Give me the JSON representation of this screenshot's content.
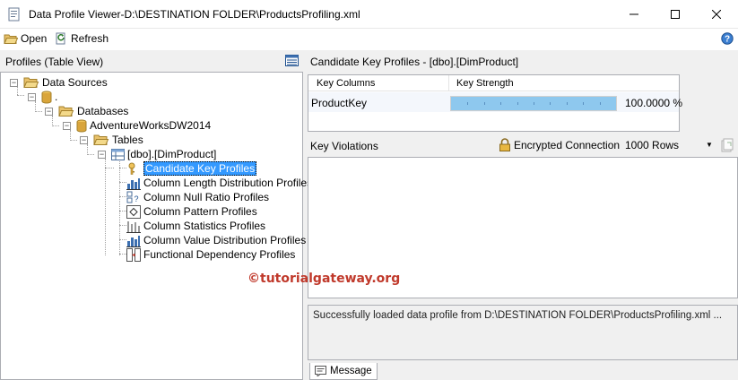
{
  "window": {
    "title": "Data Profile Viewer-D:\\DESTINATION FOLDER\\ProductsProfiling.xml",
    "app_icon": "document-icon",
    "controls": [
      "minimize-icon",
      "maximize-icon",
      "close-icon"
    ]
  },
  "toolbar": {
    "open_label": "Open",
    "refresh_label": "Refresh",
    "help_icon": "help-icon"
  },
  "left_panel": {
    "header": "Profiles (Table View)",
    "tree": {
      "data_sources": "Data Sources",
      "server": ".",
      "databases": "Databases",
      "database": "AdventureWorksDW2014",
      "tables": "Tables",
      "table": "[dbo].[DimProduct]",
      "profiles": [
        {
          "label": "Candidate Key Profiles",
          "icon": "key-icon",
          "selected": true
        },
        {
          "label": "Column Length Distribution Profiles",
          "icon": "bar-chart-icon"
        },
        {
          "label": "Column Null Ratio Profiles",
          "icon": "null-ratio-icon"
        },
        {
          "label": "Column Pattern Profiles",
          "icon": "pattern-icon"
        },
        {
          "label": "Column Statistics Profiles",
          "icon": "statistics-icon"
        },
        {
          "label": "Column Value Distribution Profiles",
          "icon": "bar-chart-icon"
        },
        {
          "label": "Functional Dependency Profiles",
          "icon": "dependency-icon"
        }
      ]
    }
  },
  "right_panel": {
    "header": "Candidate Key Profiles  -  [dbo].[DimProduct]",
    "table": {
      "columns": [
        "Key Columns",
        "Key Strength"
      ],
      "rows": [
        {
          "key": "ProductKey",
          "strength_fraction": 1.0,
          "strength_text": "100.0000 %"
        }
      ]
    },
    "violations": {
      "header": "Key Violations",
      "encrypted_label": "Encrypted Connection",
      "rows_value": "1000 Rows"
    },
    "message": "Successfully loaded data profile from D:\\DESTINATION FOLDER\\ProductsProfiling.xml ...",
    "message_tab": "Message"
  },
  "watermark": "©tutorialgateway.org",
  "colors": {
    "selection": "#3399ff",
    "bar_fill": "#8ec8ee",
    "folder": "#e8c16a",
    "database": "#d9a53b"
  }
}
